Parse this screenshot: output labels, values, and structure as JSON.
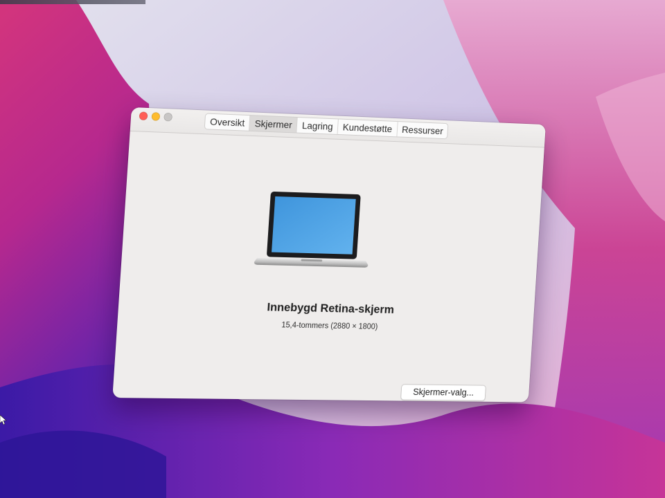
{
  "window": {
    "tabs": [
      {
        "label": "Oversikt",
        "active": false
      },
      {
        "label": "Skjermer",
        "active": true
      },
      {
        "label": "Lagring",
        "active": false
      },
      {
        "label": "Kundestøtte",
        "active": false
      },
      {
        "label": "Ressurser",
        "active": false
      }
    ],
    "traffic_lights": {
      "close_color": "#ff5f57",
      "minimize_color": "#febc2e",
      "zoom_color": "#c8c6c5"
    }
  },
  "display": {
    "icon": "laptop-icon",
    "name": "Innebygd Retina-skjerm",
    "spec": "15,4-tommers (2880 × 1800)",
    "button_label": "Skjermer-valg..."
  },
  "colors": {
    "window_bg": "#efedec",
    "screen_blue": "#4d9fe0",
    "wallpaper_magenta": "#c8287a",
    "wallpaper_violet": "#5b2bb0",
    "wallpaper_light": "#d8c8ea"
  }
}
